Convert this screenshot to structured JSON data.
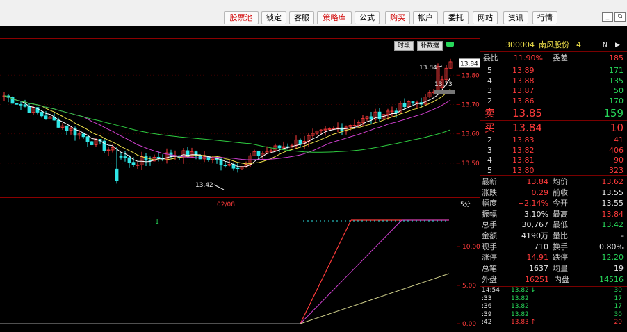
{
  "toolbar": {
    "buttons": [
      {
        "label": "股票池",
        "color": "red"
      },
      {
        "label": "锁定",
        "color": "black"
      },
      {
        "label": "客服",
        "color": "black"
      },
      {
        "label": "策略库",
        "color": "red"
      },
      {
        "label": "公式",
        "color": "black"
      },
      {
        "label": "购买",
        "color": "red"
      },
      {
        "label": "帐户",
        "color": "black"
      },
      {
        "label": "委托",
        "color": "black"
      },
      {
        "label": "网站",
        "color": "black"
      },
      {
        "label": "资讯",
        "color": "black"
      },
      {
        "label": "行情",
        "color": "black"
      }
    ],
    "win_min": "_",
    "win_restore": "⧉",
    "win_mark": "×"
  },
  "chart_tags": {
    "period": "时段",
    "supplement": "补数据"
  },
  "price_axis": {
    "ticks": [
      "13.84",
      "13.80",
      "13.70",
      "13.60",
      "13.50"
    ],
    "current": "13.84"
  },
  "annotations": {
    "high": "13.84",
    "low": "13.42",
    "mid_high": "13.73",
    "time_label": "02/08",
    "period": "5分"
  },
  "lower_axis": {
    "ticks": [
      "10.00",
      "5.00",
      "0.00"
    ]
  },
  "quote": {
    "code": "300004",
    "name": "南风股份",
    "suffix": "4",
    "weibi_label": "委比",
    "weibi": "11.90%",
    "weicha_label": "委差",
    "weicha": "185",
    "sell": [
      {
        "level": "5",
        "price": "13.89",
        "vol": "171"
      },
      {
        "level": "4",
        "price": "13.88",
        "vol": "135"
      },
      {
        "level": "3",
        "price": "13.87",
        "vol": "50"
      },
      {
        "level": "2",
        "price": "13.86",
        "vol": "170"
      }
    ],
    "sell1": {
      "label": "卖",
      "price": "13.85",
      "vol": "159"
    },
    "buy1": {
      "label": "买",
      "price": "13.84",
      "vol": "10"
    },
    "buy": [
      {
        "level": "2",
        "price": "13.83",
        "vol": "41"
      },
      {
        "level": "3",
        "price": "13.82",
        "vol": "406"
      },
      {
        "level": "4",
        "price": "13.81",
        "vol": "90"
      },
      {
        "level": "5",
        "price": "13.80",
        "vol": "323"
      }
    ],
    "stats": [
      {
        "l1": "最新",
        "v1": "13.84",
        "c1": "red",
        "l2": "均价",
        "v2": "13.62",
        "c2": "red"
      },
      {
        "l1": "涨跌",
        "v1": "0.29",
        "c1": "red",
        "l2": "前收",
        "v2": "13.55",
        "c2": "white"
      },
      {
        "l1": "幅度",
        "v1": "+2.14%",
        "c1": "red",
        "l2": "今开",
        "v2": "13.55",
        "c2": "white"
      },
      {
        "l1": "振幅",
        "v1": "3.10%",
        "c1": "white",
        "l2": "最高",
        "v2": "13.84",
        "c2": "red"
      },
      {
        "l1": "总手",
        "v1": "30,767",
        "c1": "white",
        "l2": "最低",
        "v2": "13.42",
        "c2": "green"
      },
      {
        "l1": "金额",
        "v1": "4190万",
        "c1": "white",
        "l2": "量比",
        "v2": "-",
        "c2": "white"
      },
      {
        "l1": "现手",
        "v1": "710",
        "c1": "white",
        "l2": "换手",
        "v2": "0.80%",
        "c2": "white"
      },
      {
        "l1": "涨停",
        "v1": "14.91",
        "c1": "red",
        "l2": "跌停",
        "v2": "12.20",
        "c2": "green"
      },
      {
        "l1": "总笔",
        "v1": "1637",
        "c1": "white",
        "l2": "均量",
        "v2": "19",
        "c2": "white"
      }
    ],
    "outer_label": "外盘",
    "outer": "16251",
    "inner_label": "内盘",
    "inner": "14516",
    "ticks": [
      {
        "time": "14:54",
        "price": "13.82",
        "arrow": "↓",
        "vol": "30",
        "c": "green"
      },
      {
        "time": ":33",
        "price": "13.82",
        "arrow": "",
        "vol": "17",
        "c": "green"
      },
      {
        "time": ":36",
        "price": "13.82",
        "arrow": "",
        "vol": "17",
        "c": "green"
      },
      {
        "time": ":39",
        "price": "13.82",
        "arrow": "",
        "vol": "30",
        "c": "green"
      },
      {
        "time": ":42",
        "price": "13.83",
        "arrow": "↑",
        "vol": "20",
        "c": "red"
      }
    ]
  },
  "colors": {
    "up": "#ff3b3b",
    "down": "#2ee6e6",
    "ma5": "#ffffff",
    "ma10": "#f0e14a",
    "ma20": "#d040d0",
    "ma60": "#2ecc40",
    "grid": "#8b0000"
  }
}
